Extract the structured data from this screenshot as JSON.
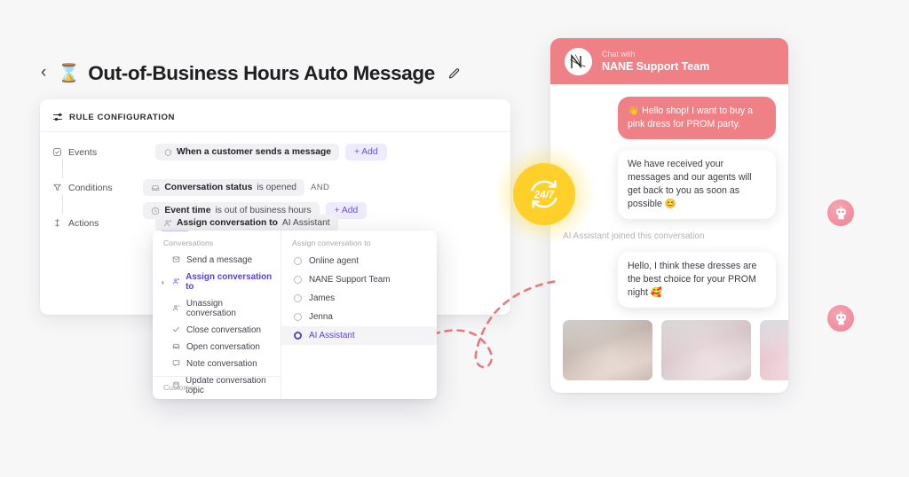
{
  "header": {
    "back_icon": "chevron-left-icon",
    "emoji": "⌛",
    "title": "Out-of-Business Hours Auto Message",
    "edit_icon": "pencil-icon"
  },
  "rule_card": {
    "section_title": "RULE CONFIGURATION",
    "rows": [
      {
        "label": "Events",
        "icon": "events-icon",
        "chips": [
          {
            "icon": "chat-icon",
            "bold": "When a customer sends a message",
            "rest": ""
          }
        ],
        "add_label": "+ Add",
        "has_add": true
      },
      {
        "label": "Conditions",
        "icon": "filter-icon",
        "chips": [
          {
            "icon": "inbox-icon",
            "bold": "Conversation status",
            "rest": "is opened"
          },
          {
            "icon": "clock-icon",
            "bold": "Event time",
            "rest": "is out of business hours"
          }
        ],
        "joiner": "AND",
        "add_label": "+ Add",
        "has_add": true
      },
      {
        "label": "Actions",
        "icon": "actions-icon",
        "chips": [
          {
            "icon": "assign-icon",
            "bold": "Assign conversation to",
            "rest": "AI Assistant"
          }
        ],
        "has_add": false
      }
    ]
  },
  "dropdown": {
    "left": {
      "caption": "Conversations",
      "items": [
        {
          "label": "Send a message",
          "icon": "send-message-icon",
          "active": false
        },
        {
          "label": "Assign conversation to",
          "icon": "assign-icon",
          "active": true
        },
        {
          "label": "Unassign conversation",
          "icon": "unassign-icon",
          "active": false
        },
        {
          "label": "Close conversation",
          "icon": "check-icon",
          "active": false
        },
        {
          "label": "Open conversation",
          "icon": "inbox-icon",
          "active": false
        },
        {
          "label": "Note conversation",
          "icon": "note-icon",
          "active": false
        },
        {
          "label": "Update conversation topic",
          "icon": "topic-icon",
          "active": false
        }
      ],
      "footer": "Customer"
    },
    "right": {
      "caption": "Assign conversation to",
      "options": [
        {
          "label": "Online agent",
          "selected": false
        },
        {
          "label": "NANE Support Team",
          "selected": false
        },
        {
          "label": "James",
          "selected": false
        },
        {
          "label": "Jenna",
          "selected": false
        },
        {
          "label": "AI Assistant",
          "selected": true
        }
      ]
    }
  },
  "badge": {
    "text": "24/7",
    "icon": "refresh-cycle-icon",
    "color": "#ffd02a"
  },
  "chat": {
    "header": {
      "avatar_letter": "N",
      "avatar_icon": "nane-logo-icon",
      "subtitle": "Chat with",
      "title": "NANE Support Team",
      "accent": "#ef8086"
    },
    "messages": [
      {
        "from": "user",
        "text": "👋 Hello shop! I want to buy a pink dress for PROM party."
      },
      {
        "from": "agent",
        "text": "We have received your messages and our agents will get back to you as soon as possible 😊",
        "avatar": "bot-avatar-icon"
      },
      {
        "from": "system",
        "text": "AI Assistant joined this conversation"
      },
      {
        "from": "agent",
        "text": "Hello, I think these dresses are the best choice for your PROM night 🥰",
        "avatar": "bot-avatar-icon"
      }
    ],
    "products": [
      {
        "name": "satin-slip-dress"
      },
      {
        "name": "tulle-ballgown-dress"
      },
      {
        "name": "floral-off-shoulder-dress"
      }
    ]
  }
}
